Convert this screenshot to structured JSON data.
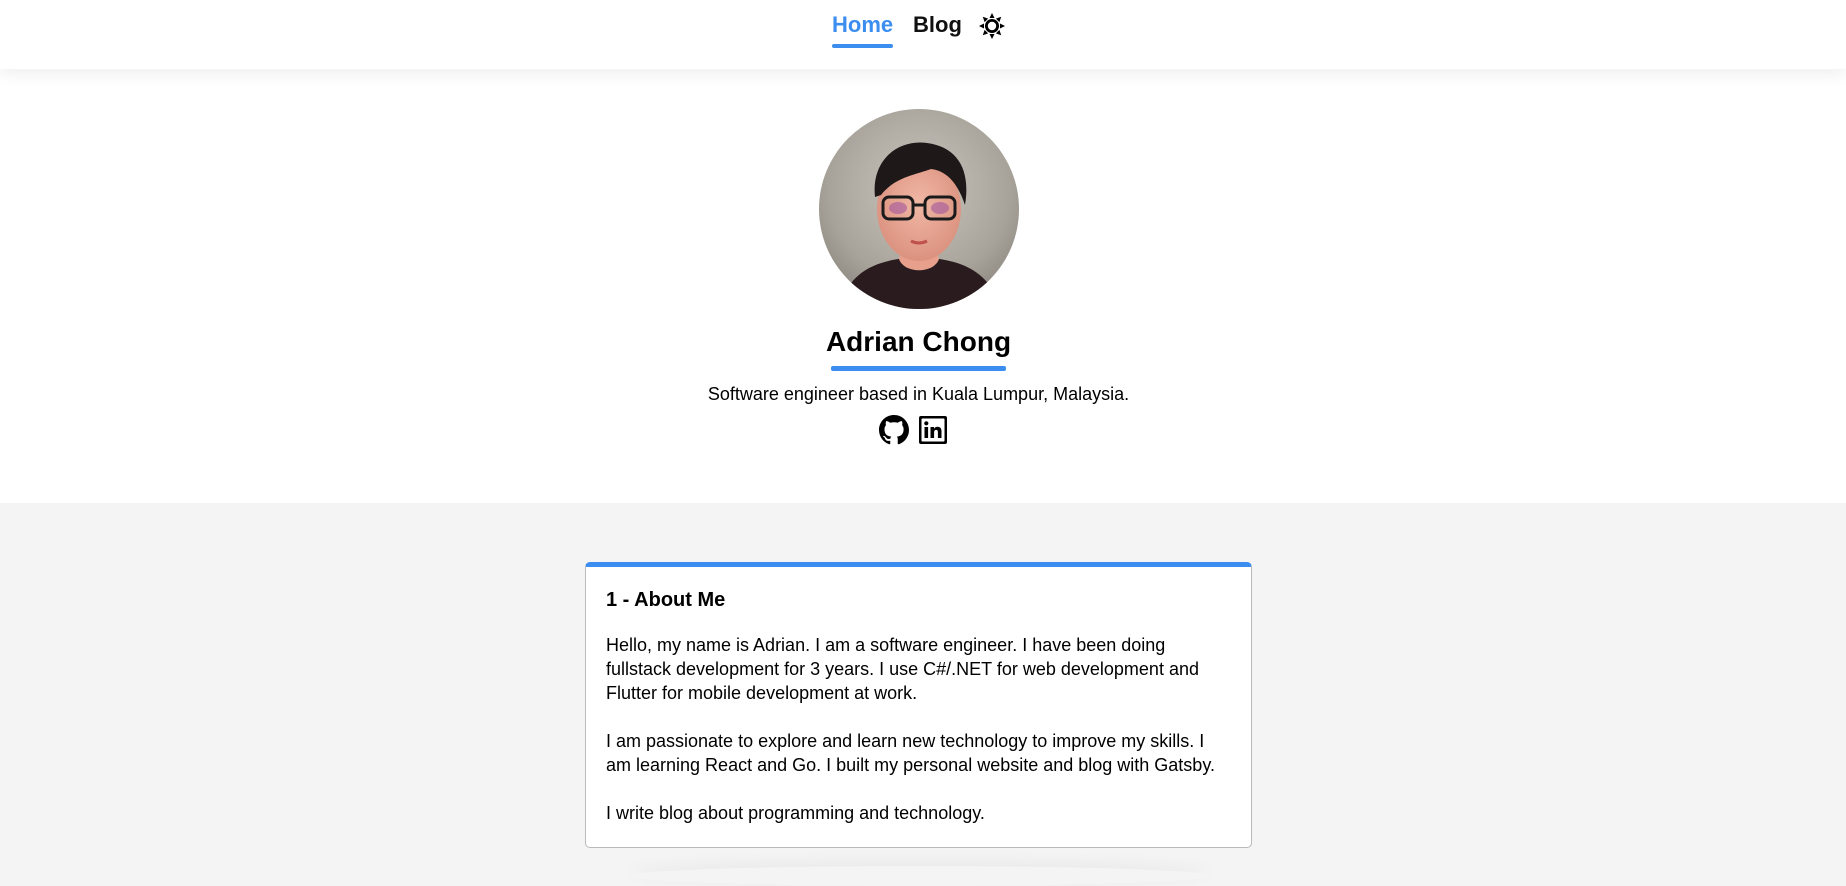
{
  "nav": {
    "home_label": "Home",
    "blog_label": "Blog",
    "theme_icon": "sun-icon",
    "active": "Home"
  },
  "profile": {
    "name": "Adrian Chong",
    "tagline": "Software engineer based in Kuala Lumpur, Malaysia.",
    "avatar_icon": "profile-photo",
    "social_icons": [
      "github-icon",
      "linkedin-icon"
    ]
  },
  "about": {
    "title": "1 - About Me",
    "paragraphs": [
      "Hello, my name is Adrian. I am a software engineer. I have been doing fullstack development for 3 years. I use C#/.NET for web development and Flutter for mobile development at work.",
      "I am passionate to explore and learn new technology to improve my skills. I am learning React and Go. I built my personal website and blog with Gatsby.",
      "I write blog about programming and technology."
    ]
  },
  "colors": {
    "accent": "#3b8ef0",
    "page_background": "#f4f4f4",
    "surface": "#ffffff",
    "text": "#000000"
  }
}
